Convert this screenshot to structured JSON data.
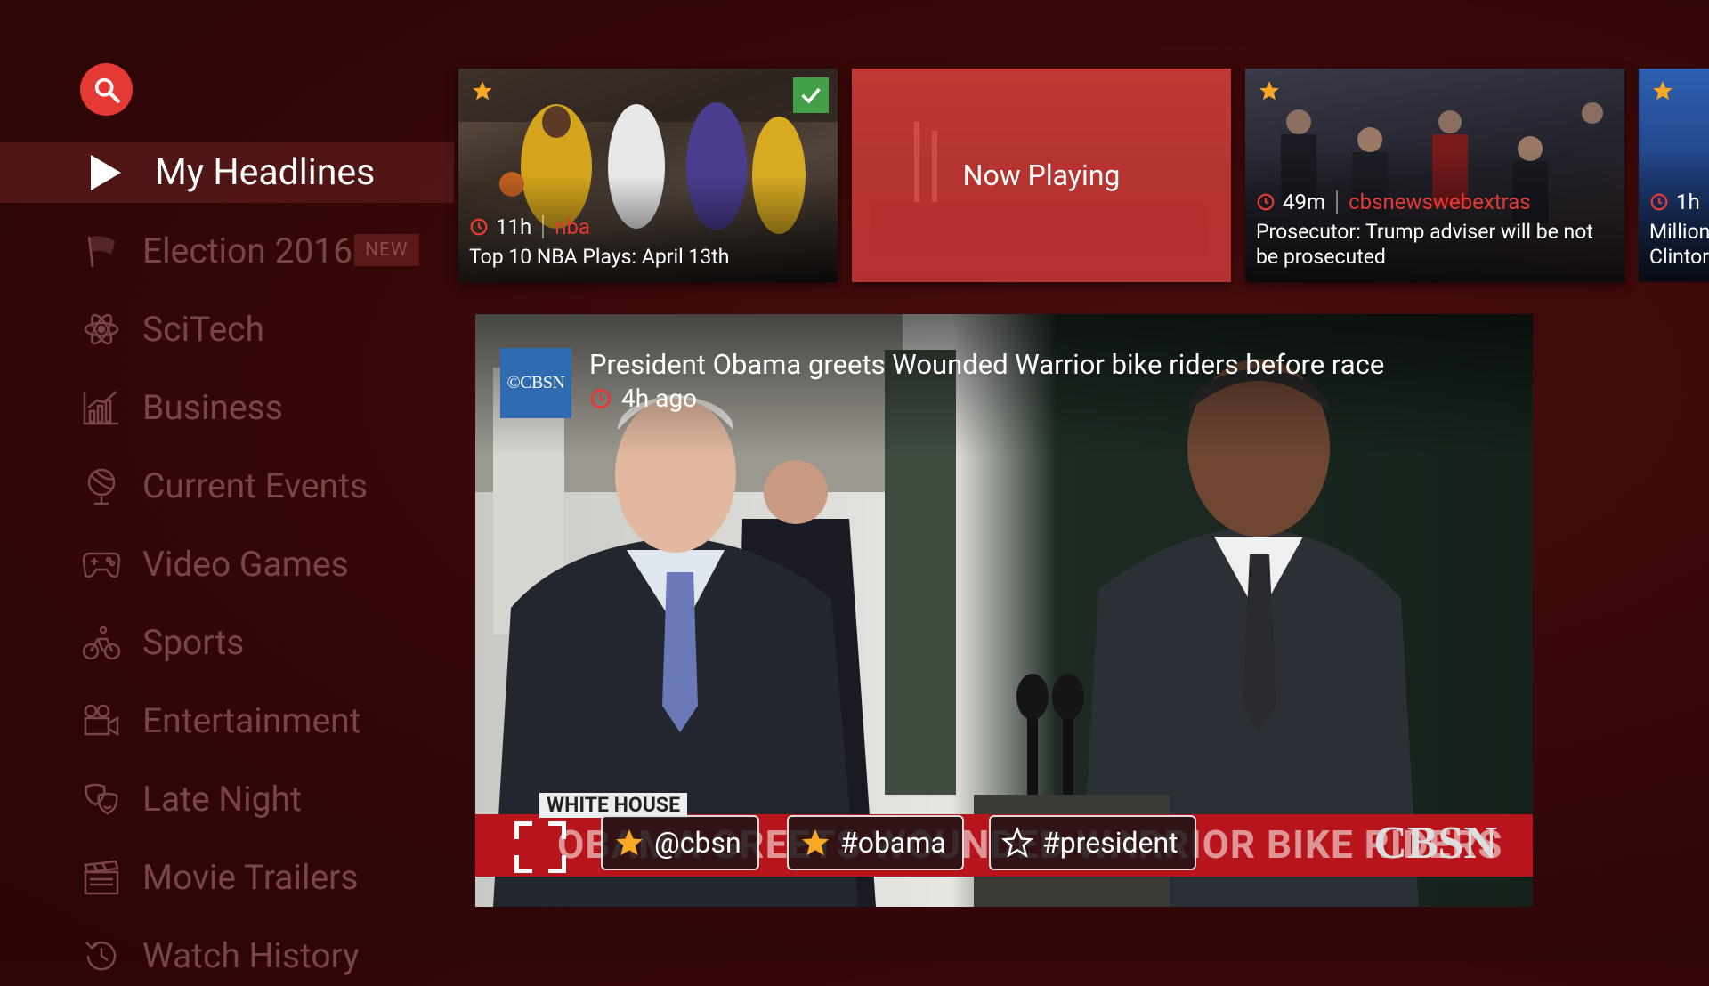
{
  "search": {
    "icon": "search-icon"
  },
  "sidebar": {
    "items": [
      {
        "label": "My Headlines",
        "icon": "play-icon",
        "active": true
      },
      {
        "label": "Election 2016",
        "icon": "flag-icon",
        "badge": "NEW"
      },
      {
        "label": "SciTech",
        "icon": "atom-icon"
      },
      {
        "label": "Business",
        "icon": "chart-icon"
      },
      {
        "label": "Current Events",
        "icon": "globe-icon"
      },
      {
        "label": "Video Games",
        "icon": "gamepad-icon"
      },
      {
        "label": "Sports",
        "icon": "bicycle-icon"
      },
      {
        "label": "Entertainment",
        "icon": "camera-icon"
      },
      {
        "label": "Late Night",
        "icon": "masks-icon"
      },
      {
        "label": "Movie Trailers",
        "icon": "clapper-icon"
      },
      {
        "label": "Watch History",
        "icon": "history-icon"
      }
    ]
  },
  "cards": [
    {
      "time": "11h",
      "source": "nba",
      "title": "Top 10 NBA Plays: April 13th",
      "starred": true,
      "watched": true
    },
    {
      "overlay": "Now Playing"
    },
    {
      "time": "49m",
      "source": "cbsnewswebextras",
      "title": "Prosecutor: Trump adviser will be not be prosecuted",
      "starred": true
    },
    {
      "time": "1h",
      "title": "Million Clintor",
      "starred": true
    }
  ],
  "video": {
    "channel_logo": "©CBSN",
    "title": "President Obama greets Wounded Warrior bike riders before race",
    "time": "4h ago",
    "lower_third_label": "WHITE HOUSE",
    "lower_third_text": "OBAMA GREETS WOUNDED WARRIOR BIKE RIDERS",
    "network": "CBSN",
    "tags": [
      {
        "label": "@cbsn",
        "starred": true
      },
      {
        "label": "#obama",
        "starred": true
      },
      {
        "label": "#president",
        "starred": false
      }
    ]
  },
  "colors": {
    "accent": "#e53935",
    "star": "#f9a825",
    "check": "#43a047"
  }
}
